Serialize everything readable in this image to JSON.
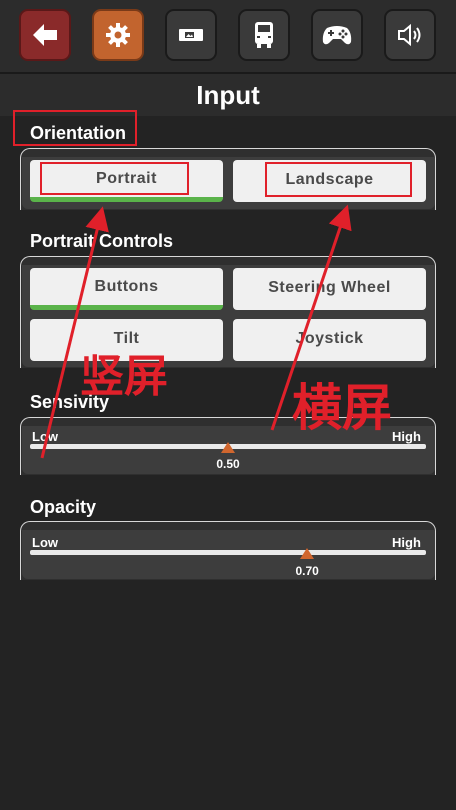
{
  "toolbar": {
    "buttons": [
      {
        "icon": "back-arrow-icon"
      },
      {
        "icon": "gear-icon",
        "active": true
      },
      {
        "icon": "image-card-icon"
      },
      {
        "icon": "truck-icon"
      },
      {
        "icon": "gamepad-icon"
      },
      {
        "icon": "speaker-icon"
      }
    ]
  },
  "page": {
    "title": "Input"
  },
  "orientation": {
    "label": "Orientation",
    "options": [
      "Portrait",
      "Landscape"
    ],
    "selected": "Portrait"
  },
  "portrait_controls": {
    "label": "Portrait Controls",
    "options": [
      "Buttons",
      "Steering Wheel",
      "Tilt",
      "Joystick"
    ],
    "selected": "Buttons"
  },
  "sensitivity": {
    "label": "Sensivity",
    "low": "Low",
    "high": "High",
    "value": "0.50",
    "fraction": 0.5
  },
  "opacity": {
    "label": "Opacity",
    "low": "Low",
    "high": "High",
    "value": "0.70",
    "fraction": 0.7
  },
  "annotations": {
    "portrait_note": "竖屏",
    "landscape_note": "横屏"
  },
  "colors": {
    "accent_selected": "#5ab34a",
    "slider_thumb": "#d0662e",
    "annotation": "#e0202a"
  }
}
